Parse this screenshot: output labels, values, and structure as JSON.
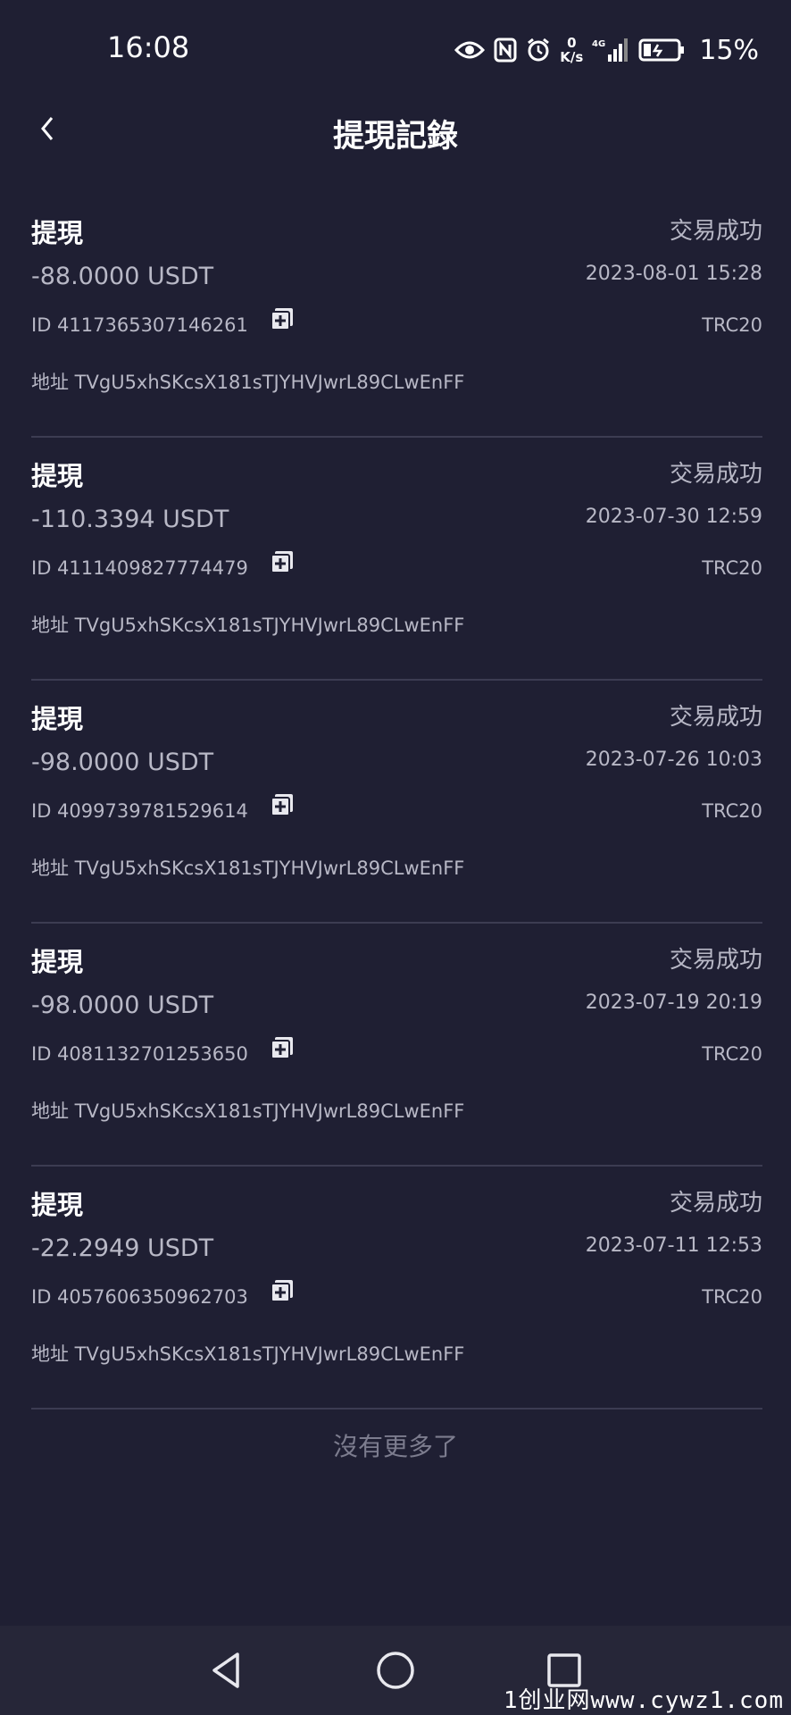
{
  "status_bar": {
    "time": "16:08",
    "net_speed_value": "0",
    "net_speed_unit": "K/s",
    "network_type": "4G",
    "battery": "15%"
  },
  "header": {
    "title": "提現記錄",
    "back_icon": "chevron-left-icon"
  },
  "records": [
    {
      "type": "提現",
      "status": "交易成功",
      "amount": "-88.0000 USDT",
      "date": "2023-08-01 15:28",
      "id": "ID 4117365307146261",
      "network": "TRC20",
      "address": "地址 TVgU5xhSKcsX181sTJYHVJwrL89CLwEnFF"
    },
    {
      "type": "提現",
      "status": "交易成功",
      "amount": "-110.3394 USDT",
      "date": "2023-07-30 12:59",
      "id": "ID 4111409827774479",
      "network": "TRC20",
      "address": "地址 TVgU5xhSKcsX181sTJYHVJwrL89CLwEnFF"
    },
    {
      "type": "提現",
      "status": "交易成功",
      "amount": "-98.0000 USDT",
      "date": "2023-07-26 10:03",
      "id": "ID 4099739781529614",
      "network": "TRC20",
      "address": "地址 TVgU5xhSKcsX181sTJYHVJwrL89CLwEnFF"
    },
    {
      "type": "提現",
      "status": "交易成功",
      "amount": "-98.0000 USDT",
      "date": "2023-07-19 20:19",
      "id": "ID 4081132701253650",
      "network": "TRC20",
      "address": "地址 TVgU5xhSKcsX181sTJYHVJwrL89CLwEnFF"
    },
    {
      "type": "提現",
      "status": "交易成功",
      "amount": "-22.2949 USDT",
      "date": "2023-07-11 12:53",
      "id": "ID 4057606350962703",
      "network": "TRC20",
      "address": "地址 TVgU5xhSKcsX181sTJYHVJwrL89CLwEnFF"
    }
  ],
  "footer": {
    "no_more": "沒有更多了"
  },
  "watermark": "1创业网www.cywz1.com",
  "colors": {
    "background": "#1f1f33",
    "nav_bar": "#262638",
    "divider": "#3c3c52",
    "secondary_text": "#b8b8c6"
  }
}
